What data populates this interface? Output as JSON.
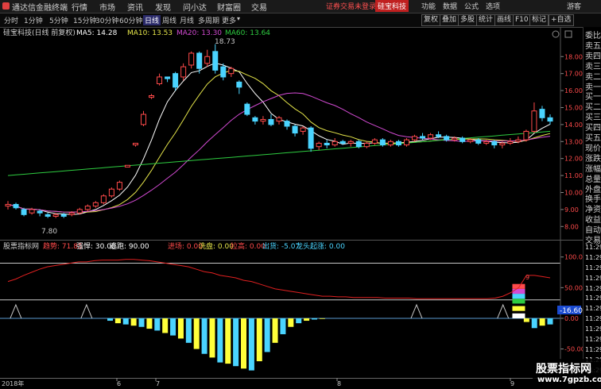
{
  "topbar": {
    "app_name": "通达信金融终端",
    "menus": [
      "行情",
      "市场",
      "资讯",
      "发现",
      "问小达",
      "财富圈",
      "交易"
    ],
    "warning": "证券交易未登录",
    "stock_tag": "硅宝科技",
    "right_menus": [
      "功能",
      "数据",
      "公式",
      "选项"
    ],
    "guest": "游客"
  },
  "toolbar": {
    "periods": [
      "分时",
      "1分钟",
      "5分钟",
      "15分钟",
      "30分钟",
      "60分钟",
      "日线",
      "周线",
      "月线",
      "多周期",
      "更多"
    ],
    "active_period": "日线",
    "right_buttons": [
      "复权",
      "叠加",
      "多股",
      "统计",
      "画线",
      "F10",
      "标记",
      "+自选"
    ]
  },
  "main": {
    "title": "硅宝科技(日线 前复权)",
    "ma5_label": "MA5: 14.28",
    "ma10_label": "MA10: 13.53",
    "ma20_label": "MA20: 13.30",
    "ma60_label": "MA60: 13.64",
    "high_annotation": "18.73",
    "low_annotation": "7.80",
    "colors": {
      "up": "#ff4a4a",
      "down": "#4ad4ff",
      "ma5": "#ffffff",
      "ma10": "#e6e64a",
      "ma20": "#d24ad2",
      "ma60": "#2ecc40"
    }
  },
  "indicator": {
    "name": "股票指标网",
    "qushi_label": "趋势: 71.85",
    "qianghan_label": "强悍: 30.00",
    "taopao_label": "逃跑: 90.00",
    "jincang_label": "进场: 0.00",
    "xipan_label": "洗盘: 0.00",
    "lasheng_label": "拉高: 0.00",
    "chuhuo_label": "出货: -5.07",
    "longtou_label": "龙头起涨: 0.00",
    "current_value": "-16.60",
    "marker_9": "9"
  },
  "bottom_axis": {
    "labels": [
      "2018年",
      "6",
      "7",
      "8",
      "9"
    ]
  },
  "right_panel": {
    "items": [
      "委比",
      "卖五",
      "卖四",
      "卖三",
      "卖二",
      "卖一",
      "买一",
      "买二",
      "买三",
      "买四",
      "买五",
      "现价",
      "涨跌",
      "涨幅",
      "总量",
      "外盘",
      "换手",
      "净资",
      "收益",
      "自动",
      "交易",
      "11:29",
      "11:29",
      "11:29",
      "11:29",
      "11:29",
      "11:29",
      "11:29",
      "11:29",
      "11:29",
      "11:29",
      "11:29",
      "11:29",
      "11:29"
    ]
  },
  "watermark": {
    "title": "股票指标网",
    "url": "www.7gpzb.com"
  },
  "chart_data": [
    {
      "type": "candlestick",
      "title": "硅宝科技(日线 前复权)",
      "y_ticks": [
        "18.00",
        "17.00",
        "16.00",
        "15.00",
        "14.00",
        "13.00",
        "12.00",
        "11.00",
        "10.00",
        "9.00",
        "8.00"
      ],
      "ylim": [
        7.5,
        18.9
      ],
      "candles": [
        {
          "o": 9.2,
          "c": 9.3,
          "h": 9.5,
          "l": 9.0
        },
        {
          "o": 9.3,
          "c": 9.1,
          "h": 9.4,
          "l": 9.0
        },
        {
          "o": 9.0,
          "c": 8.7,
          "h": 9.1,
          "l": 8.6
        },
        {
          "o": 8.8,
          "c": 9.0,
          "h": 9.1,
          "l": 8.7
        },
        {
          "o": 8.9,
          "c": 8.8,
          "h": 9.0,
          "l": 8.6
        },
        {
          "o": 8.7,
          "c": 8.6,
          "h": 8.8,
          "l": 8.5
        },
        {
          "o": 8.6,
          "c": 8.7,
          "h": 8.8,
          "l": 8.5
        },
        {
          "o": 8.7,
          "c": 8.6,
          "h": 8.8,
          "l": 8.5
        },
        {
          "o": 8.7,
          "c": 8.8,
          "h": 8.9,
          "l": 8.6
        },
        {
          "o": 8.8,
          "c": 9.0,
          "h": 9.1,
          "l": 8.7
        },
        {
          "o": 9.0,
          "c": 9.2,
          "h": 9.3,
          "l": 8.9
        },
        {
          "o": 9.2,
          "c": 9.4,
          "h": 9.5,
          "l": 9.1
        },
        {
          "o": 9.4,
          "c": 9.8,
          "h": 9.9,
          "l": 9.3
        },
        {
          "o": 9.8,
          "c": 10.2,
          "h": 10.3,
          "l": 9.7
        },
        {
          "o": 10.2,
          "c": 10.6,
          "h": 10.7,
          "l": 10.1
        },
        {
          "o": 11.5,
          "c": 11.6,
          "h": 11.6,
          "l": 11.5
        },
        {
          "o": 12.8,
          "c": 12.9,
          "h": 12.9,
          "l": 12.7
        },
        {
          "o": 14.0,
          "c": 14.6,
          "h": 14.8,
          "l": 13.9
        },
        {
          "o": 15.6,
          "c": 15.7,
          "h": 15.8,
          "l": 15.5
        },
        {
          "o": 16.4,
          "c": 16.8,
          "h": 17.0,
          "l": 16.3
        },
        {
          "o": 16.8,
          "c": 16.7,
          "h": 16.8,
          "l": 16.5
        },
        {
          "o": 17.0,
          "c": 16.2,
          "h": 17.1,
          "l": 16.0
        },
        {
          "o": 16.8,
          "c": 17.4,
          "h": 17.6,
          "l": 16.6
        },
        {
          "o": 17.5,
          "c": 18.2,
          "h": 18.3,
          "l": 17.3
        },
        {
          "o": 18.2,
          "c": 17.3,
          "h": 18.3,
          "l": 17.0
        },
        {
          "o": 17.6,
          "c": 18.0,
          "h": 18.4,
          "l": 17.4
        },
        {
          "o": 18.3,
          "c": 17.2,
          "h": 18.73,
          "l": 17.0
        },
        {
          "o": 17.4,
          "c": 16.8,
          "h": 17.6,
          "l": 16.6
        },
        {
          "o": 17.0,
          "c": 17.3,
          "h": 17.4,
          "l": 16.8
        },
        {
          "o": 16.5,
          "c": 16.2,
          "h": 16.6,
          "l": 15.8
        },
        {
          "o": 15.2,
          "c": 14.6,
          "h": 15.3,
          "l": 14.5
        },
        {
          "o": 14.4,
          "c": 14.2,
          "h": 14.5,
          "l": 14.0
        },
        {
          "o": 14.2,
          "c": 14.3,
          "h": 14.5,
          "l": 14.0
        },
        {
          "o": 14.3,
          "c": 14.0,
          "h": 14.6,
          "l": 13.9
        },
        {
          "o": 14.2,
          "c": 14.4,
          "h": 14.5,
          "l": 14.0
        },
        {
          "o": 14.2,
          "c": 13.9,
          "h": 14.3,
          "l": 13.7
        },
        {
          "o": 13.9,
          "c": 13.5,
          "h": 14.0,
          "l": 13.3
        },
        {
          "o": 13.6,
          "c": 13.8,
          "h": 13.9,
          "l": 13.4
        },
        {
          "o": 13.8,
          "c": 12.6,
          "h": 13.9,
          "l": 12.4
        },
        {
          "o": 12.7,
          "c": 12.9,
          "h": 13.0,
          "l": 12.5
        },
        {
          "o": 12.9,
          "c": 12.8,
          "h": 13.1,
          "l": 12.6
        },
        {
          "o": 12.8,
          "c": 13.0,
          "h": 13.2,
          "l": 12.7
        },
        {
          "o": 13.0,
          "c": 12.9,
          "h": 13.1,
          "l": 12.8
        },
        {
          "o": 12.9,
          "c": 13.0,
          "h": 13.1,
          "l": 12.7
        },
        {
          "o": 13.0,
          "c": 12.7,
          "h": 13.1,
          "l": 12.6
        },
        {
          "o": 12.7,
          "c": 12.9,
          "h": 13.0,
          "l": 12.6
        },
        {
          "o": 12.9,
          "c": 13.1,
          "h": 13.2,
          "l": 12.8
        },
        {
          "o": 13.1,
          "c": 12.8,
          "h": 13.2,
          "l": 12.7
        },
        {
          "o": 12.8,
          "c": 13.0,
          "h": 13.1,
          "l": 12.7
        },
        {
          "o": 13.0,
          "c": 12.8,
          "h": 13.1,
          "l": 12.7
        },
        {
          "o": 12.8,
          "c": 13.1,
          "h": 13.2,
          "l": 12.7
        },
        {
          "o": 13.1,
          "c": 13.3,
          "h": 13.4,
          "l": 13.0
        },
        {
          "o": 13.3,
          "c": 13.2,
          "h": 13.5,
          "l": 13.1
        },
        {
          "o": 13.2,
          "c": 13.4,
          "h": 13.5,
          "l": 13.1
        },
        {
          "o": 13.4,
          "c": 13.3,
          "h": 13.6,
          "l": 13.2
        },
        {
          "o": 13.3,
          "c": 13.1,
          "h": 13.4,
          "l": 13.0
        },
        {
          "o": 13.1,
          "c": 13.2,
          "h": 13.3,
          "l": 13.0
        },
        {
          "o": 13.2,
          "c": 13.0,
          "h": 13.3,
          "l": 12.9
        },
        {
          "o": 13.0,
          "c": 13.1,
          "h": 13.2,
          "l": 12.9
        },
        {
          "o": 13.1,
          "c": 12.9,
          "h": 13.2,
          "l": 12.8
        },
        {
          "o": 12.9,
          "c": 13.0,
          "h": 13.1,
          "l": 12.8
        },
        {
          "o": 13.0,
          "c": 12.8,
          "h": 13.1,
          "l": 12.6
        },
        {
          "o": 12.8,
          "c": 12.9,
          "h": 13.0,
          "l": 12.6
        },
        {
          "o": 12.9,
          "c": 13.0,
          "h": 13.2,
          "l": 12.8
        },
        {
          "o": 13.0,
          "c": 13.1,
          "h": 13.3,
          "l": 12.9
        },
        {
          "o": 13.1,
          "c": 13.6,
          "h": 13.7,
          "l": 13.0
        },
        {
          "o": 13.6,
          "c": 14.8,
          "h": 15.3,
          "l": 13.5
        },
        {
          "o": 14.9,
          "c": 14.4,
          "h": 15.1,
          "l": 14.2
        },
        {
          "o": 14.4,
          "c": 14.2,
          "h": 14.6,
          "l": 14.0
        }
      ]
    },
    {
      "type": "bar",
      "title": "股票指标网",
      "y_ticks": [
        "100.00",
        "50.00",
        "0.00",
        "-50.00"
      ],
      "ylim": [
        -92,
        110
      ],
      "values": [
        0,
        0,
        0,
        0,
        0,
        0,
        0,
        0,
        0,
        0,
        0,
        0,
        0,
        -4,
        -8,
        -10,
        -12,
        -14,
        -17,
        -20,
        -24,
        -28,
        -33,
        -40,
        -50,
        -58,
        -64,
        -72,
        -74,
        -78,
        -82,
        -85,
        -70,
        -55,
        -40,
        -26,
        -14,
        -8,
        -4,
        -2,
        -1,
        0,
        0,
        0,
        0,
        0,
        0,
        0,
        0,
        0,
        0,
        0,
        0,
        0,
        0,
        0,
        0,
        0,
        0,
        0,
        0,
        0,
        0,
        0,
        0,
        0,
        -6,
        -16,
        -12,
        -10
      ],
      "bar_colors": "alternating yellow/cyan",
      "trend_line": [
        60,
        64,
        70,
        75,
        80,
        84,
        86,
        88,
        90,
        92,
        92,
        94,
        95,
        95,
        95,
        96,
        96,
        95,
        94,
        92,
        90,
        88,
        86,
        84,
        80,
        76,
        74,
        70,
        68,
        66,
        62,
        60,
        56,
        52,
        48,
        46,
        44,
        42,
        40,
        38,
        36,
        36,
        35,
        35,
        34,
        34,
        34,
        34,
        33,
        33,
        33,
        33,
        32,
        32,
        32,
        32,
        32,
        32,
        32,
        32,
        32,
        32,
        33,
        36,
        42,
        50,
        70,
        70,
        68,
        66
      ]
    }
  ]
}
